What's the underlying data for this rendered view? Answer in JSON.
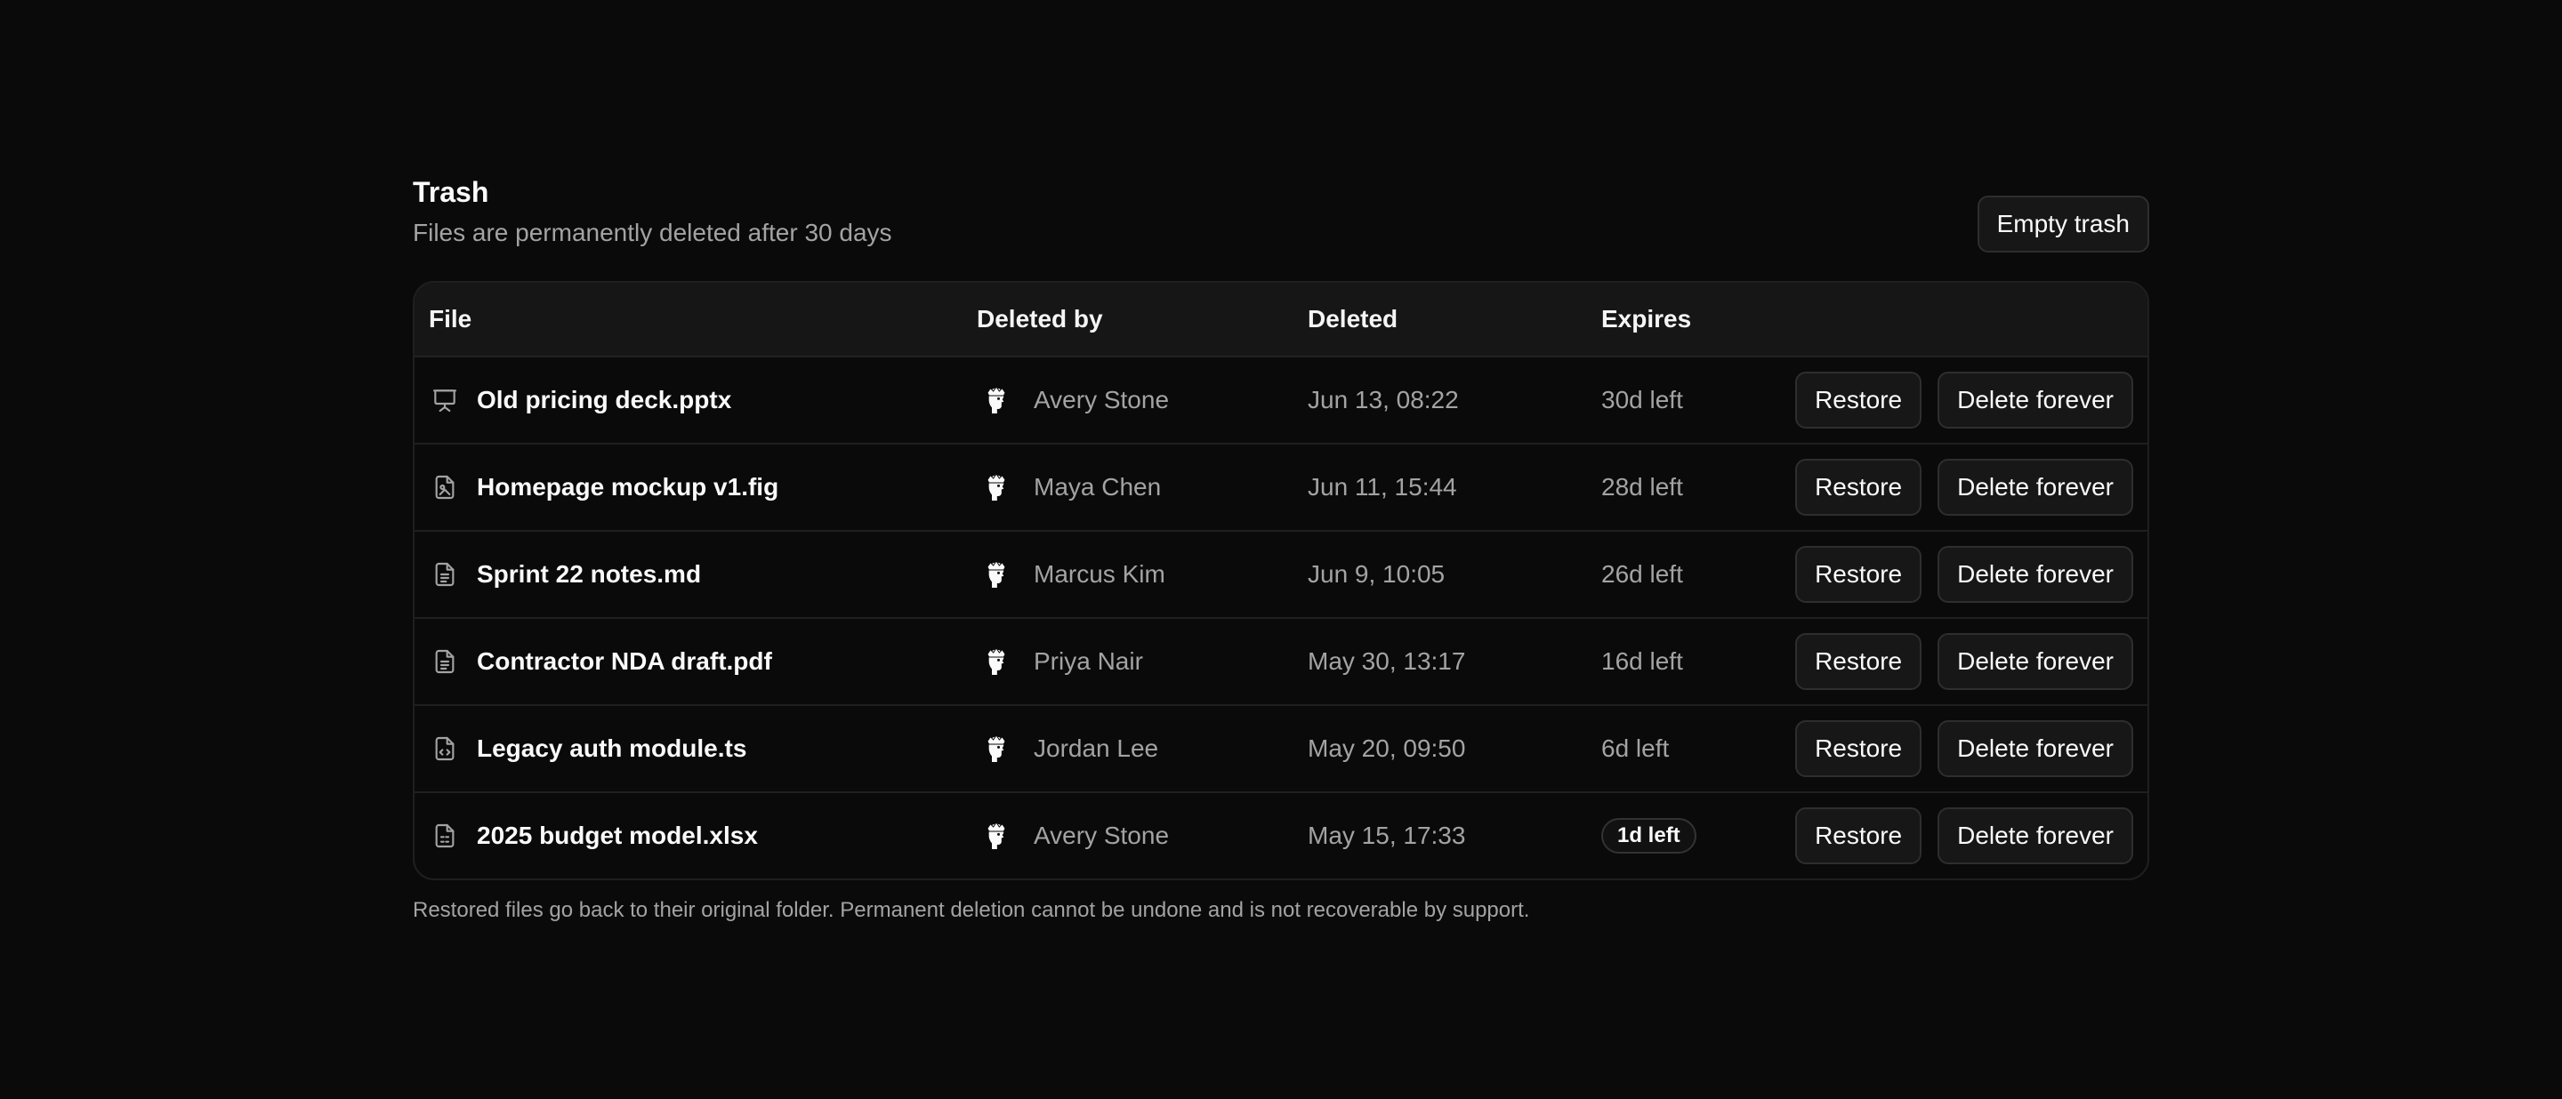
{
  "header": {
    "title": "Trash",
    "subtitle": "Files are permanently deleted after 30 days",
    "empty_label": "Empty trash"
  },
  "table": {
    "columns": [
      "File",
      "Deleted by",
      "Deleted",
      "Expires"
    ],
    "rows": [
      {
        "icon": "presentation-icon",
        "name": "Old pricing deck.pptx",
        "by": "Avery Stone",
        "deleted": "Jun 13, 08:22",
        "expires": "30d left",
        "urgent": false
      },
      {
        "icon": "image-file-icon",
        "name": "Homepage mockup v1.fig",
        "by": "Maya Chen",
        "deleted": "Jun 11, 15:44",
        "expires": "28d left",
        "urgent": false
      },
      {
        "icon": "text-file-icon",
        "name": "Sprint 22 notes.md",
        "by": "Marcus Kim",
        "deleted": "Jun 9, 10:05",
        "expires": "26d left",
        "urgent": false
      },
      {
        "icon": "text-file-icon",
        "name": "Contractor NDA draft.pdf",
        "by": "Priya Nair",
        "deleted": "May 30, 13:17",
        "expires": "16d left",
        "urgent": false
      },
      {
        "icon": "code-file-icon",
        "name": "Legacy auth module.ts",
        "by": "Jordan Lee",
        "deleted": "May 20, 09:50",
        "expires": "6d left",
        "urgent": false
      },
      {
        "icon": "spreadsheet-file-icon",
        "name": "2025 budget model.xlsx",
        "by": "Avery Stone",
        "deleted": "May 15, 17:33",
        "expires": "1d left",
        "urgent": true
      }
    ],
    "restore_label": "Restore",
    "delete_label": "Delete forever"
  },
  "footnote": "Restored files go back to their original folder. Permanent deletion cannot be undone and is not recoverable by support.",
  "colors": {
    "background": "#0a0a0a",
    "surface": "#161616",
    "border": "#1f1f1f",
    "text": "#fafafa",
    "muted": "#a3a3a3"
  }
}
